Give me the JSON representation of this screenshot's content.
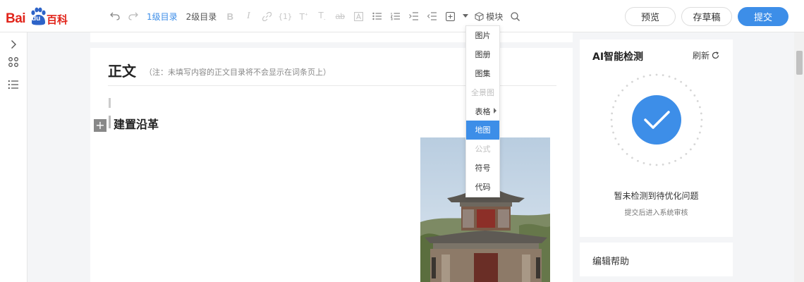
{
  "logo": {
    "bai": "Bai",
    "du": "du",
    "baike": "百科"
  },
  "toolbar": {
    "heading1": "1级目录",
    "heading2": "2级目录",
    "module_label": "模块",
    "preview_label": "预览",
    "draft_label": "存草稿",
    "submit_label": "提交",
    "icons": [
      "undo-icon",
      "redo-icon",
      "bold-icon",
      "italic-icon",
      "link-icon",
      "formula-icon",
      "superscript-icon",
      "subscript-icon",
      "strikethrough-icon",
      "text-box-icon",
      "bullet-list-icon",
      "numbered-list-icon",
      "indent-icon",
      "outdent-icon",
      "insert-icon",
      "dropdown-arrow-icon",
      "module-icon",
      "search-icon"
    ]
  },
  "insert_menu": {
    "items": [
      {
        "label": "图片",
        "state": "normal"
      },
      {
        "label": "图册",
        "state": "normal"
      },
      {
        "label": "图集",
        "state": "normal"
      },
      {
        "label": "全景图",
        "state": "disabled"
      },
      {
        "label": "表格",
        "state": "submenu"
      },
      {
        "label": "地图",
        "state": "active"
      },
      {
        "label": "公式",
        "state": "disabled"
      },
      {
        "label": "符号",
        "state": "normal"
      },
      {
        "label": "代码",
        "state": "normal"
      }
    ]
  },
  "editor": {
    "title": "正文",
    "note": "（注：未填写内容的正文目录将不会显示在词条页上）",
    "section_title": "建置沿革",
    "plus_label": "+"
  },
  "ai_panel": {
    "title": "AI智能检测",
    "refresh_label": "刷新",
    "message": "暂未检测到待优化问题",
    "sub_message": "提交后进入系统审核",
    "accent": "#3d8ee8"
  },
  "help_panel": {
    "title": "编辑帮助"
  }
}
